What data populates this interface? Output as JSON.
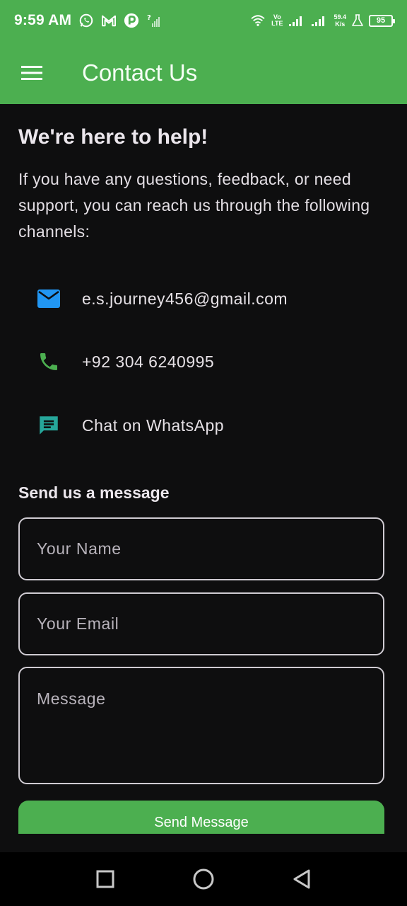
{
  "status_bar": {
    "time": "9:59 AM",
    "network_label_top": "Vo",
    "network_label_bottom": "LTE",
    "speed_value": "59.4",
    "speed_unit": "K/s",
    "battery": "95"
  },
  "app_bar": {
    "title": "Contact Us",
    "menu_icon": "hamburger-menu-icon"
  },
  "intro": {
    "heading": "We're here to help!",
    "body": "If you have any questions, feedback, or need support, you can reach us through the following channels:"
  },
  "contacts": [
    {
      "icon": "email-icon",
      "text": "e.s.journey456@gmail.com",
      "color": "#2196f3"
    },
    {
      "icon": "phone-icon",
      "text": "+92 304 6240995",
      "color": "#4caf50"
    },
    {
      "icon": "chat-icon",
      "text": "Chat on WhatsApp",
      "color": "#26a69a"
    }
  ],
  "form": {
    "heading": "Send us a message",
    "name_placeholder": "Your Name",
    "email_placeholder": "Your Email",
    "message_placeholder": "Message",
    "send_label": "Send Message"
  },
  "colors": {
    "accent": "#4caf50",
    "background": "#0e0e0f"
  }
}
